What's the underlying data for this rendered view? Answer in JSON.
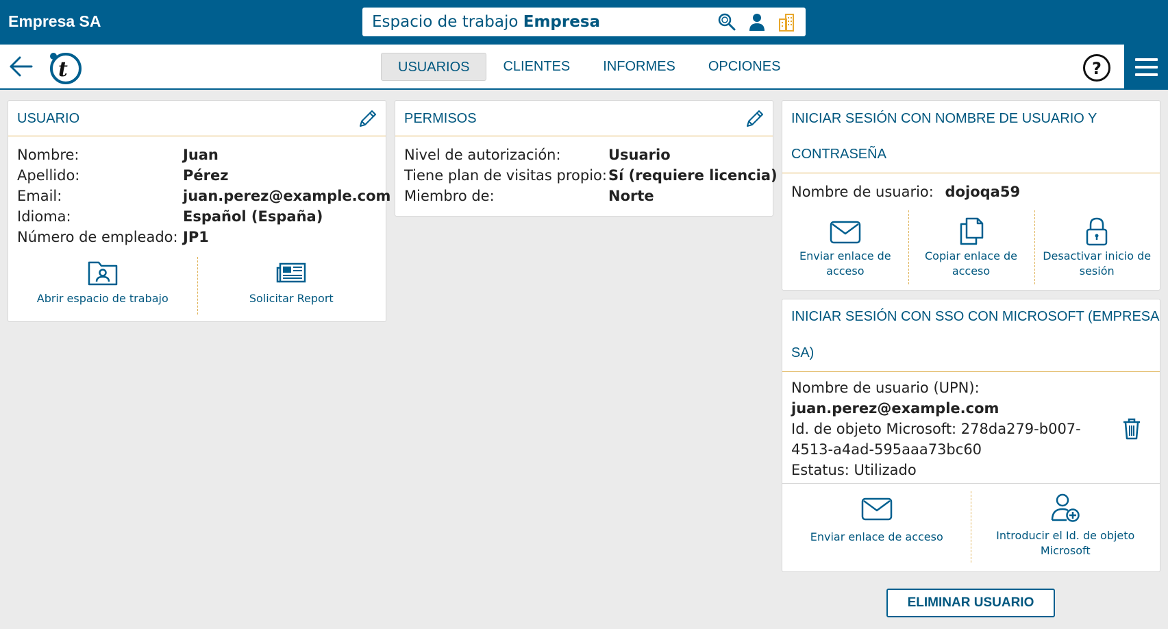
{
  "app": {
    "brand": "Empresa SA"
  },
  "workspace": {
    "prefix": "Espacio de trabajo",
    "name": "Empresa"
  },
  "nav": {
    "tabs": [
      {
        "label": "USUARIOS",
        "active": true
      },
      {
        "label": "CLIENTES",
        "active": false
      },
      {
        "label": "INFORMES",
        "active": false
      },
      {
        "label": "OPCIONES",
        "active": false
      }
    ]
  },
  "user_card": {
    "title": "USUARIO",
    "fields": [
      {
        "label": "Nombre:",
        "value": "Juan"
      },
      {
        "label": "Apellido:",
        "value": "Pérez"
      },
      {
        "label": "Email:",
        "value": "juan.perez@example.com"
      },
      {
        "label": "Idioma:",
        "value": "Español (España)"
      },
      {
        "label": "Número de empleado:",
        "value": "JP1"
      }
    ],
    "actions": [
      {
        "label": "Abrir espacio de trabajo",
        "icon": "folder-user-icon"
      },
      {
        "label": "Solicitar Report",
        "icon": "newspaper-icon"
      }
    ]
  },
  "permissions_card": {
    "title": "PERMISOS",
    "fields": [
      {
        "label": "Nivel de autorización:",
        "value": "Usuario"
      },
      {
        "label": "Tiene plan de visitas propio:",
        "value": "Sí (requiere licencia)"
      },
      {
        "label": "Miembro de:",
        "value": "Norte"
      }
    ]
  },
  "login_card": {
    "title_line1": "INICIAR SESIÓN CON NOMBRE DE USUARIO Y",
    "title_line2": "CONTRASEÑA",
    "username_label": "Nombre de usuario:",
    "username_value": "dojoqa59",
    "actions": [
      {
        "label_line1": "Enviar enlace de",
        "label_line2": "acceso",
        "icon": "envelope-icon"
      },
      {
        "label_line1": "Copiar enlace de",
        "label_line2": "acceso",
        "icon": "copy-icon"
      },
      {
        "label_line1": "Desactivar inicio de",
        "label_line2": "sesión",
        "icon": "lock-icon"
      }
    ]
  },
  "sso_card": {
    "title_line1": "INICIAR SESIÓN CON SSO CON MICROSOFT (EMPRESA",
    "title_line2": "SA)",
    "upn_label": "Nombre de usuario (UPN):",
    "upn_value": "juan.perez@example.com",
    "object_id_line1": "Id. de objeto Microsoft: 278da279-b007-",
    "object_id_line2": "4513-a4ad-595aaa73bc60",
    "status": "Estatus: Utilizado",
    "actions": [
      {
        "label_line1": "Enviar enlace de acceso",
        "label_line2": "",
        "icon": "envelope-icon"
      },
      {
        "label_line1": "Introducir el Id. de objeto",
        "label_line2": "Microsoft",
        "icon": "user-add-icon"
      }
    ]
  },
  "delete_button": {
    "label": "ELIMINAR USUARIO"
  },
  "colors": {
    "primary": "#005f8f",
    "accent_line": "#e0b45a",
    "link": "#00577f",
    "building_icon": "#e8a72c"
  }
}
